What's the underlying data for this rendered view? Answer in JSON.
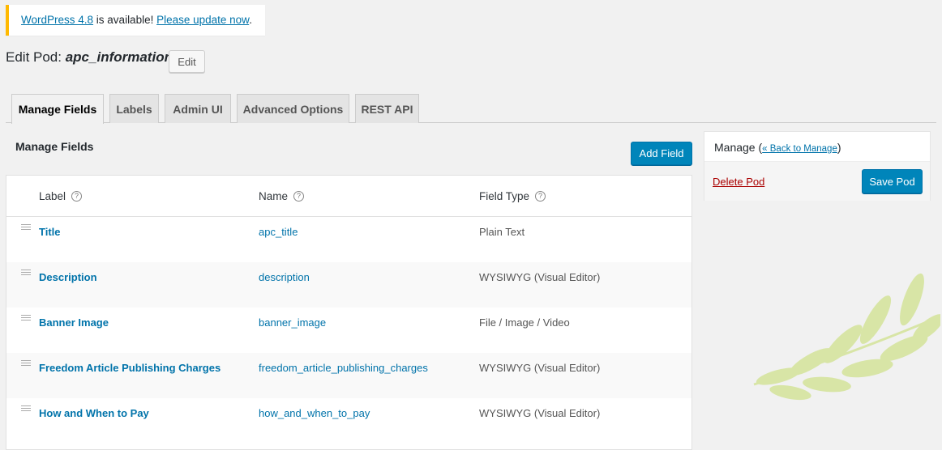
{
  "notice": {
    "version_link": "WordPress 4.8",
    "middle_text": " is available! ",
    "update_link": "Please update now",
    "end_text": "."
  },
  "header": {
    "title_prefix": "Edit Pod: ",
    "pod_name": "apc_information",
    "edit_button": "Edit"
  },
  "tabs": [
    {
      "label": "Manage Fields",
      "active": true
    },
    {
      "label": "Labels"
    },
    {
      "label": "Admin UI"
    },
    {
      "label": "Advanced Options"
    },
    {
      "label": "REST API"
    }
  ],
  "manage_fields": {
    "title": "Manage Fields",
    "add_button": "Add Field",
    "columns": {
      "label": "Label",
      "name": "Name",
      "type": "Field Type"
    },
    "help_glyph": "?",
    "rows": [
      {
        "label": "Title",
        "name": "apc_title",
        "type": "Plain Text"
      },
      {
        "label": "Description",
        "name": "description",
        "type": "WYSIWYG (Visual Editor)"
      },
      {
        "label": "Banner Image",
        "name": "banner_image",
        "type": "File / Image / Video"
      },
      {
        "label": "Freedom Article Publishing Charges",
        "name": "freedom_article_publishing_charges",
        "type": "WYSIWYG (Visual Editor)"
      },
      {
        "label": "How and When to Pay",
        "name": "how_and_when_to_pay",
        "type": "WYSIWYG (Visual Editor)"
      }
    ]
  },
  "manage_box": {
    "title": "Manage",
    "back_open": " (",
    "back_link": "« Back to Manage",
    "back_close": ")",
    "delete_link": "Delete Pod",
    "save_button": "Save Pod"
  },
  "colors": {
    "primary": "#0085ba",
    "link": "#0073aa",
    "delete": "#aa0000",
    "notice_border": "#ffb900",
    "leaf": "#d4e49a"
  }
}
